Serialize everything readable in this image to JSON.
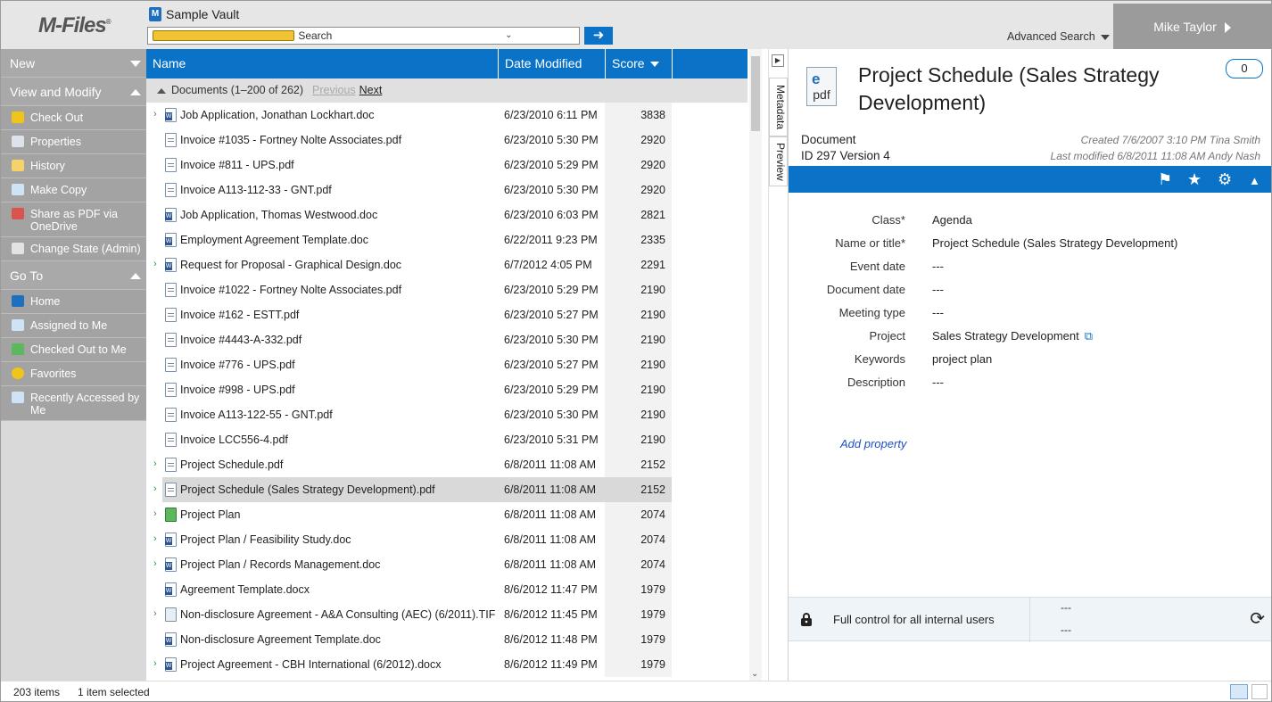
{
  "app": {
    "logo": "M-Files",
    "vault_name": "Sample Vault",
    "user": "Mike Taylor"
  },
  "search": {
    "placeholder": "Search",
    "advanced_label": "Advanced Search"
  },
  "tasks": {
    "new_label": "New",
    "view_modify_label": "View and Modify",
    "view_modify_items": [
      "Check Out",
      "Properties",
      "History",
      "Make Copy",
      "Share as PDF via OneDrive",
      "Change State (Admin)"
    ],
    "goto_label": "Go To",
    "goto_items": [
      "Home",
      "Assigned to Me",
      "Checked Out to Me",
      "Favorites",
      "Recently Accessed by Me"
    ]
  },
  "list": {
    "columns": {
      "name": "Name",
      "date": "Date Modified",
      "score": "Score"
    },
    "group": {
      "label": "Documents (1–200 of 262)",
      "previous": "Previous",
      "next": "Next"
    },
    "rows": [
      {
        "name": "Job Application, Jonathan Lockhart.doc",
        "date": "6/23/2010 6:11 PM",
        "score": "3838",
        "icon": "doc",
        "expand": true
      },
      {
        "name": "Invoice #1035 - Fortney Nolte Associates.pdf",
        "date": "6/23/2010 5:30 PM",
        "score": "2920",
        "icon": "pdf",
        "expand": false
      },
      {
        "name": "Invoice #811 - UPS.pdf",
        "date": "6/23/2010 5:29 PM",
        "score": "2920",
        "icon": "pdf",
        "expand": false
      },
      {
        "name": "Invoice A113-112-33 - GNT.pdf",
        "date": "6/23/2010 5:30 PM",
        "score": "2920",
        "icon": "pdf",
        "expand": false
      },
      {
        "name": "Job Application, Thomas Westwood.doc",
        "date": "6/23/2010 6:03 PM",
        "score": "2821",
        "icon": "doc",
        "expand": false
      },
      {
        "name": "Employment Agreement Template.doc",
        "date": "6/22/2011 9:23 PM",
        "score": "2335",
        "icon": "doc",
        "expand": false
      },
      {
        "name": "Request for Proposal - Graphical Design.doc",
        "date": "6/7/2012 4:05 PM",
        "score": "2291",
        "icon": "doc",
        "expand": true
      },
      {
        "name": "Invoice #1022 - Fortney Nolte Associates.pdf",
        "date": "6/23/2010 5:29 PM",
        "score": "2190",
        "icon": "pdf",
        "expand": false
      },
      {
        "name": "Invoice #162 - ESTT.pdf",
        "date": "6/23/2010 5:27 PM",
        "score": "2190",
        "icon": "pdf",
        "expand": false
      },
      {
        "name": "Invoice #4443-A-332.pdf",
        "date": "6/23/2010 5:30 PM",
        "score": "2190",
        "icon": "pdf",
        "expand": false
      },
      {
        "name": "Invoice #776 - UPS.pdf",
        "date": "6/23/2010 5:27 PM",
        "score": "2190",
        "icon": "pdf",
        "expand": false
      },
      {
        "name": "Invoice #998 - UPS.pdf",
        "date": "6/23/2010 5:29 PM",
        "score": "2190",
        "icon": "pdf",
        "expand": false
      },
      {
        "name": "Invoice A113-122-55 - GNT.pdf",
        "date": "6/23/2010 5:30 PM",
        "score": "2190",
        "icon": "pdf",
        "expand": false
      },
      {
        "name": "Invoice LCC556-4.pdf",
        "date": "6/23/2010 5:31 PM",
        "score": "2190",
        "icon": "pdf",
        "expand": false
      },
      {
        "name": "Project Schedule.pdf",
        "date": "6/8/2011 11:08 AM",
        "score": "2152",
        "icon": "pdf",
        "expand": true
      },
      {
        "name": "Project Schedule (Sales Strategy Development).pdf",
        "date": "6/8/2011 11:08 AM",
        "score": "2152",
        "icon": "pdf",
        "expand": true,
        "selected": true
      },
      {
        "name": "Project Plan",
        "date": "6/8/2011 11:08 AM",
        "score": "2074",
        "icon": "prj",
        "expand": true
      },
      {
        "name": "Project Plan / Feasibility Study.doc",
        "date": "6/8/2011 11:08 AM",
        "score": "2074",
        "icon": "doc",
        "expand": true
      },
      {
        "name": "Project Plan / Records Management.doc",
        "date": "6/8/2011 11:08 AM",
        "score": "2074",
        "icon": "doc",
        "expand": true
      },
      {
        "name": "Agreement Template.docx",
        "date": "8/6/2012 11:47 PM",
        "score": "1979",
        "icon": "doc",
        "expand": false
      },
      {
        "name": "Non-disclosure Agreement - A&A Consulting (AEC) (6/2011).TIF",
        "date": "8/6/2012 11:45 PM",
        "score": "1979",
        "icon": "tif",
        "expand": true
      },
      {
        "name": "Non-disclosure Agreement Template.doc",
        "date": "8/6/2012 11:48 PM",
        "score": "1979",
        "icon": "doc",
        "expand": false
      },
      {
        "name": "Project Agreement - CBH International (6/2012).docx",
        "date": "8/6/2012 11:49 PM",
        "score": "1979",
        "icon": "doc",
        "expand": true
      }
    ]
  },
  "side_tabs": {
    "metadata": "Metadata",
    "preview": "Preview"
  },
  "metadata": {
    "title": "Project Schedule (Sales Strategy Development)",
    "file_ext": "pdf",
    "comment_count": "0",
    "class_label": "Document",
    "id_version": "ID 297  Version 4",
    "created": "Created 7/6/2007 3:10 PM Tina Smith",
    "modified": "Last modified 6/8/2011 11:08 AM Andy Nash",
    "properties": [
      {
        "label": "Class*",
        "value": "Agenda"
      },
      {
        "label": "Name or title*",
        "value": "Project Schedule (Sales Strategy Development)"
      },
      {
        "label": "Event date",
        "value": "---"
      },
      {
        "label": "Document date",
        "value": "---"
      },
      {
        "label": "Meeting type",
        "value": "---"
      },
      {
        "label": "Project",
        "value": "Sales Strategy Development",
        "link": true
      },
      {
        "label": "Keywords",
        "value": "project plan"
      },
      {
        "label": "Description",
        "value": "---"
      }
    ],
    "add_property": "Add property",
    "permissions": "Full control for all internal users",
    "workflow": "---",
    "workflow_state": "---"
  },
  "status": {
    "items": "203 items",
    "selected": "1 item selected"
  },
  "colors": {
    "accent": "#0b73c7",
    "task_pane": "#a3a3a3"
  }
}
